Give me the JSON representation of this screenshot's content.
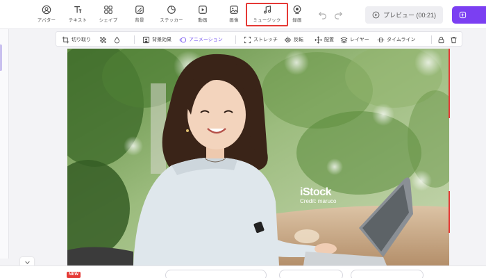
{
  "toolbar": {
    "tools": [
      {
        "label": "アバター",
        "icon": "avatar-icon"
      },
      {
        "label": "テキスト",
        "icon": "text-icon"
      },
      {
        "label": "シェイプ",
        "icon": "shape-icon"
      },
      {
        "label": "背景",
        "icon": "background-icon"
      },
      {
        "label": "ステッカー",
        "icon": "sticker-icon"
      },
      {
        "label": "動画",
        "icon": "video-icon"
      },
      {
        "label": "画像",
        "icon": "image-icon"
      },
      {
        "label": "ミュージック",
        "icon": "music-icon"
      },
      {
        "label": "録画",
        "icon": "record-icon"
      }
    ],
    "active_tool": "ミュージック",
    "preview_label": "プレビュー (00:21)",
    "accent_color": "#7b3ff2",
    "highlight_color": "#e53935"
  },
  "edit_toolbar": {
    "crop": "切り取り",
    "bg_effect": "背景効果",
    "animation": "アニメーション",
    "stretch": "ストレッチ",
    "flip": "反転",
    "arrange": "配置",
    "layer": "レイヤー",
    "timeline": "タイムライン"
  },
  "photo": {
    "watermark_logo": "iStock",
    "watermark_credit": "Credit: maruco"
  },
  "bottom": {
    "new_badge": "NEW"
  }
}
